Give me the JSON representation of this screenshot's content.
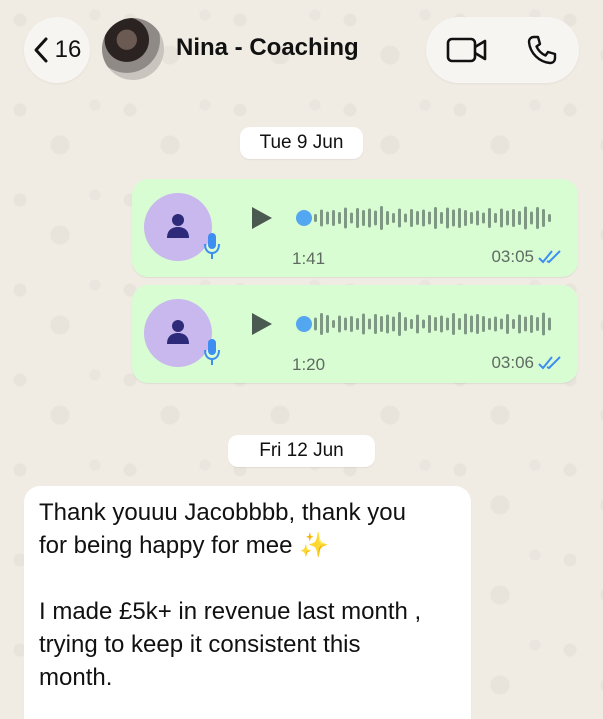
{
  "header": {
    "back_count": "16",
    "contact_name": "Nina - Coaching",
    "icons": {
      "back": "chevron-left-icon",
      "video": "video-camera-icon",
      "phone": "phone-icon"
    }
  },
  "messages": {
    "date_1": "Tue 9 Jun",
    "voice_1": {
      "duration": "1:41",
      "time": "03:05",
      "status": "read"
    },
    "voice_2": {
      "duration": "1:20",
      "time": "03:06",
      "status": "read"
    },
    "date_2": "Fri 12 Jun",
    "text_1": {
      "line_1": "Thank youuu Jacobbbb, thank you",
      "line_2": "for being happy for mee ✨",
      "line_3": "I made £5k+ in revenue last month ,",
      "line_4": "trying to keep it consistent this",
      "line_5": "month."
    }
  },
  "colors": {
    "outgoing_bubble": "#d9fdd3",
    "incoming_bubble": "#ffffff",
    "wallpaper": "#efeae2",
    "voice_accent": "#53a6f0",
    "read_ticks": "#53bdeb"
  }
}
